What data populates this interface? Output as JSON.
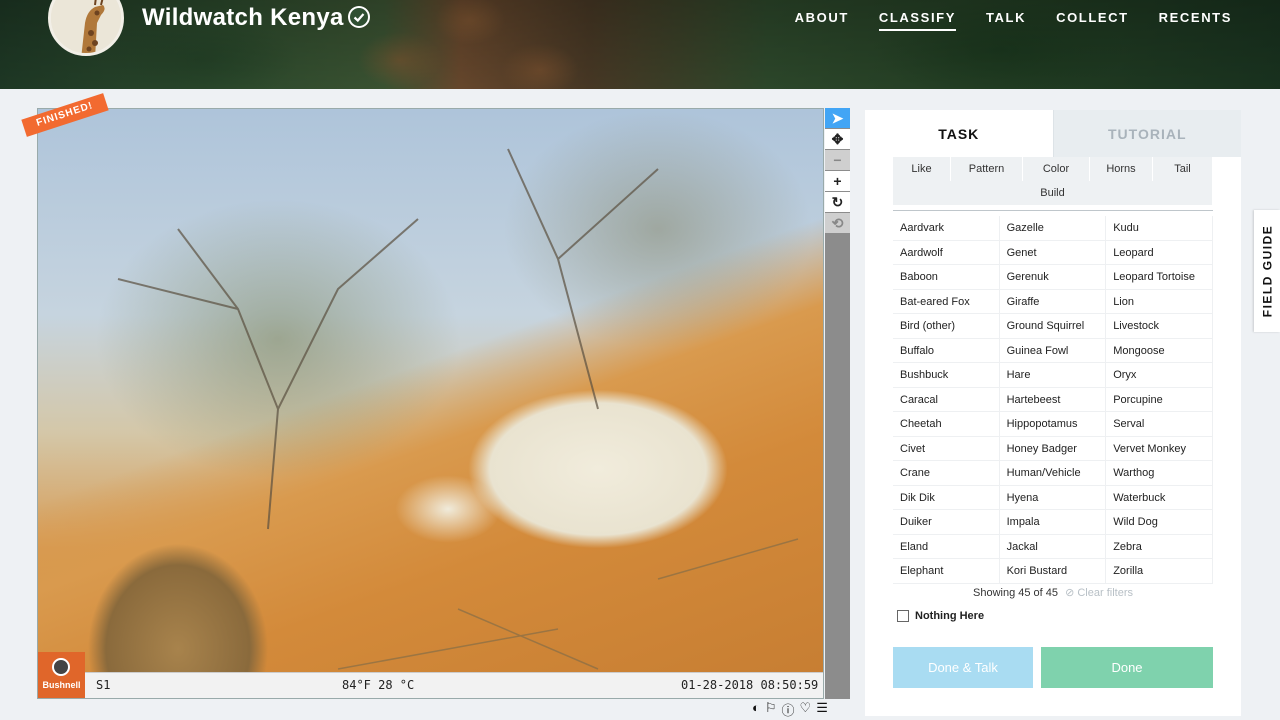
{
  "header": {
    "title": "Wildwatch Kenya",
    "nav": [
      "ABOUT",
      "CLASSIFY",
      "TALK",
      "COLLECT",
      "RECENTS"
    ],
    "active_nav": "CLASSIFY"
  },
  "viewer": {
    "badge": "FINISHED!",
    "camera_brand": "Bushnell",
    "camera_id": "S1",
    "temperature": "84°F 28 °C",
    "timestamp": "01-28-2018 08:50:59",
    "tools": [
      "pointer-icon",
      "move-icon",
      "zoom-out-icon",
      "zoom-in-icon",
      "rotate-icon",
      "reset-icon"
    ]
  },
  "panel": {
    "tabs": [
      "TASK",
      "TUTORIAL"
    ],
    "filters": [
      "Like",
      "Pattern",
      "Color",
      "Horns",
      "Tail",
      "Build"
    ],
    "choices": [
      [
        "Aardvark",
        "Gazelle",
        "Kudu"
      ],
      [
        "Aardwolf",
        "Genet",
        "Leopard"
      ],
      [
        "Baboon",
        "Gerenuk",
        "Leopard Tortoise"
      ],
      [
        "Bat-eared Fox",
        "Giraffe",
        "Lion"
      ],
      [
        "Bird (other)",
        "Ground Squirrel",
        "Livestock"
      ],
      [
        "Buffalo",
        "Guinea Fowl",
        "Mongoose"
      ],
      [
        "Bushbuck",
        "Hare",
        "Oryx"
      ],
      [
        "Caracal",
        "Hartebeest",
        "Porcupine"
      ],
      [
        "Cheetah",
        "Hippopotamus",
        "Serval"
      ],
      [
        "Civet",
        "Honey Badger",
        "Vervet Monkey"
      ],
      [
        "Crane",
        "Human/Vehicle",
        "Warthog"
      ],
      [
        "Dik Dik",
        "Hyena",
        "Waterbuck"
      ],
      [
        "Duiker",
        "Impala",
        "Wild Dog"
      ],
      [
        "Eland",
        "Jackal",
        "Zebra"
      ],
      [
        "Elephant",
        "Kori Bustard",
        "Zorilla"
      ]
    ],
    "showing": "Showing 45 of 45",
    "clear_filters": "Clear filters",
    "nothing_here": "Nothing Here",
    "done_talk": "Done & Talk",
    "done": "Done"
  },
  "field_guide": "FIELD GUIDE",
  "colors": {
    "accent_blue": "#42a5f5",
    "done_green": "#7fd2ad",
    "talk_blue": "#a9dcf2",
    "finished_orange": "#f26a30"
  }
}
